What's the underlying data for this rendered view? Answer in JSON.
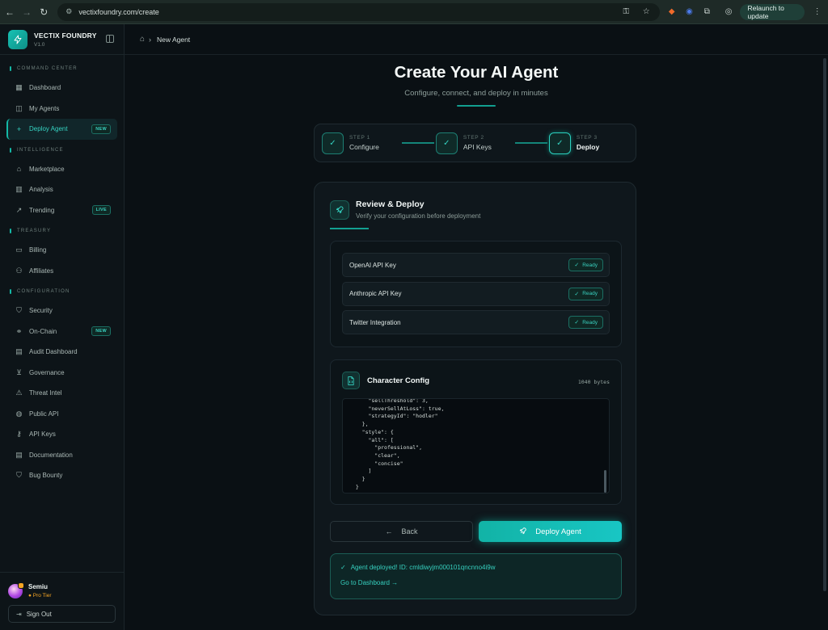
{
  "browser": {
    "url": "vectixfoundry.com/create",
    "relaunch_label": "Relaunch to update"
  },
  "brand": {
    "name": "VECTIX FOUNDRY",
    "version": "V1.0"
  },
  "sidebar": {
    "sections": [
      {
        "label": "COMMAND CENTER",
        "items": [
          {
            "label": "Dashboard",
            "icon": "grid-icon"
          },
          {
            "label": "My Agents",
            "icon": "bot-icon"
          },
          {
            "label": "Deploy Agent",
            "icon": "plus-icon",
            "active": true,
            "tag": "NEW"
          }
        ]
      },
      {
        "label": "INTELLIGENCE",
        "items": [
          {
            "label": "Marketplace",
            "icon": "store-icon"
          },
          {
            "label": "Analysis",
            "icon": "bar-chart-icon"
          },
          {
            "label": "Trending",
            "icon": "trending-up-icon",
            "tag": "LIVE"
          }
        ]
      },
      {
        "label": "TREASURY",
        "items": [
          {
            "label": "Billing",
            "icon": "wallet-icon"
          },
          {
            "label": "Affiliates",
            "icon": "users-icon"
          }
        ]
      },
      {
        "label": "CONFIGURATION",
        "items": [
          {
            "label": "Security",
            "icon": "shield-icon"
          },
          {
            "label": "On-Chain",
            "icon": "link-icon",
            "tag": "NEW"
          },
          {
            "label": "Audit Dashboard",
            "icon": "file-icon"
          },
          {
            "label": "Governance",
            "icon": "vote-icon"
          },
          {
            "label": "Threat Intel",
            "icon": "alert-triangle-icon"
          },
          {
            "label": "Public API",
            "icon": "globe-icon"
          },
          {
            "label": "API Keys",
            "icon": "key-icon"
          },
          {
            "label": "Documentation",
            "icon": "doc-icon"
          },
          {
            "label": "Bug Bounty",
            "icon": "shield-icon"
          }
        ]
      }
    ],
    "user": {
      "name": "Semiu",
      "tier": "Pro Tier"
    },
    "sign_out_label": "Sign Out"
  },
  "breadcrumb": {
    "current": "New Agent"
  },
  "page": {
    "title": "Create Your AI Agent",
    "subtitle": "Configure, connect, and deploy in minutes"
  },
  "steps": [
    {
      "num": "STEP 1",
      "name": "Configure",
      "status": "complete"
    },
    {
      "num": "STEP 2",
      "name": "API Keys",
      "status": "complete"
    },
    {
      "num": "STEP 3",
      "name": "Deploy",
      "status": "current"
    }
  ],
  "review": {
    "title": "Review & Deploy",
    "subtitle": "Verify your configuration before deployment",
    "keys": [
      {
        "label": "OpenAI API Key",
        "status": "Ready"
      },
      {
        "label": "Anthropic API Key",
        "status": "Ready"
      },
      {
        "label": "Twitter Integration",
        "status": "Ready"
      }
    ]
  },
  "config": {
    "title": "Character Config",
    "size": "1040 bytes",
    "code": "      \"sellThreshold\": 3,\n      \"neverSellAtLoss\": true,\n      \"strategyId\": \"hodler\"\n    },\n    \"style\": {\n      \"all\": [\n        \"professional\",\n        \"clear\",\n        \"concise\"\n      ]\n    }\n  }"
  },
  "actions": {
    "back_label": "Back",
    "deploy_label": "Deploy Agent"
  },
  "result": {
    "message": "Agent deployed! ID: cmldiwyjm000101qncnno4i9w",
    "link_label": "Go to Dashboard →"
  },
  "colors": {
    "accent": "#14b8a6",
    "background": "#0a1014",
    "warning": "#f5a524"
  }
}
